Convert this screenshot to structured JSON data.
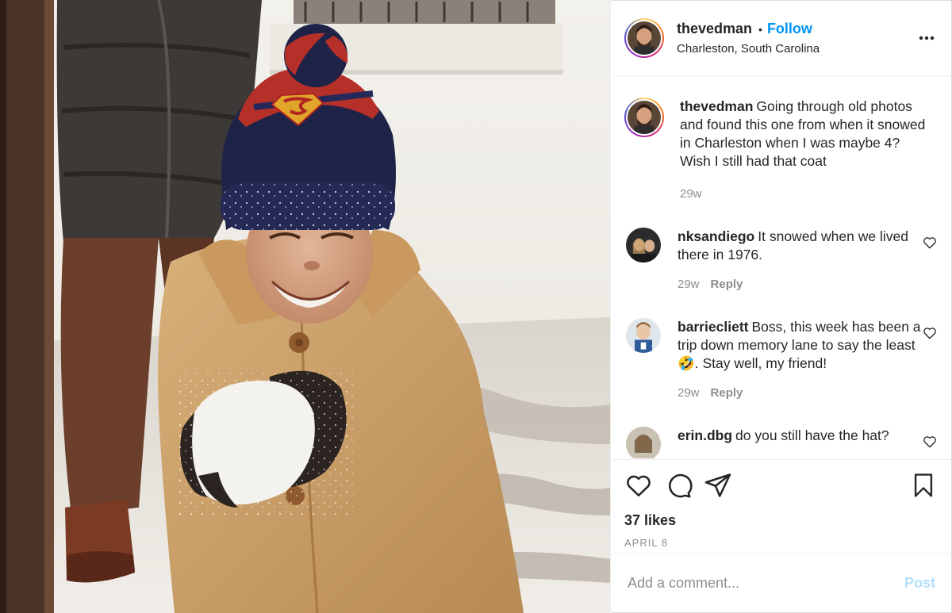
{
  "post": {
    "author": "thevedman",
    "follow_label": "Follow",
    "separator": "•",
    "location": "Charleston, South Carolina",
    "more_icon": "more-horizontal-icon"
  },
  "caption": {
    "user": "thevedman",
    "text": "Going through old photos and found this one from when it snowed in Charleston when I was maybe 4? Wish I still had that coat",
    "age": "29w"
  },
  "comments": [
    {
      "user": "nksandiego",
      "text": "It snowed when we lived there in 1976.",
      "age": "29w",
      "reply_label": "Reply"
    },
    {
      "user": "barriecliett",
      "text": "Boss, this week has been a trip down memory lane to say the least 🤣. Stay well, my friend!",
      "age": "29w",
      "reply_label": "Reply"
    },
    {
      "user": "erin.dbg",
      "text": "do you still have the hat?"
    }
  ],
  "actions": {
    "like_icon": "heart-icon",
    "comment_icon": "comment-bubble-icon",
    "share_icon": "paper-plane-icon",
    "save_icon": "bookmark-icon"
  },
  "likes": "37 likes",
  "date": "APRIL 8",
  "comment_box": {
    "placeholder": "Add a comment...",
    "post_label": "Post"
  },
  "colors": {
    "accent": "#0095f6",
    "post_disabled": "#b2dffc",
    "muted": "#8e8e8e",
    "text": "#262626"
  }
}
